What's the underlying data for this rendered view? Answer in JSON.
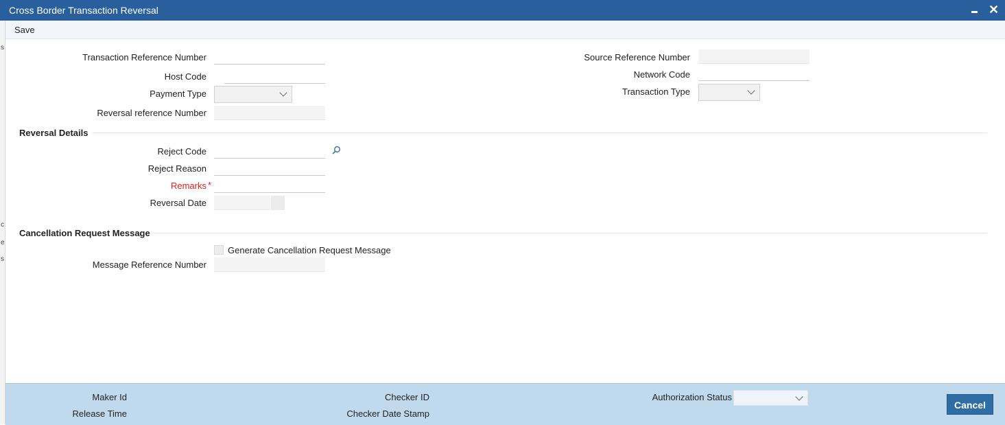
{
  "window": {
    "title": "Cross Border Transaction Reversal",
    "minimize_icon": "minimize-icon",
    "close_icon": "close-icon",
    "close_glyph": "✕"
  },
  "toolbar": {
    "save_label": "Save"
  },
  "main": {
    "transaction_reference_number": {
      "label": "Transaction Reference Number",
      "value": ""
    },
    "host_code": {
      "label": "Host Code",
      "value": ""
    },
    "payment_type": {
      "label": "Payment Type",
      "value": ""
    },
    "reversal_reference_number": {
      "label": "Reversal reference Number",
      "value": ""
    },
    "source_reference_number": {
      "label": "Source Reference Number",
      "value": ""
    },
    "network_code": {
      "label": "Network Code",
      "value": ""
    },
    "transaction_type": {
      "label": "Transaction Type",
      "value": ""
    }
  },
  "reversal_details": {
    "heading": "Reversal Details",
    "reject_code": {
      "label": "Reject Code",
      "value": "",
      "icon": "search-icon"
    },
    "reject_reason": {
      "label": "Reject Reason",
      "value": ""
    },
    "remarks": {
      "label": "Remarks",
      "required_mark": "*",
      "value": ""
    },
    "reversal_date": {
      "label": "Reversal Date",
      "value": ""
    }
  },
  "cancellation": {
    "heading": "Cancellation Request Message",
    "generate_checkbox": {
      "label": "Generate Cancellation Request Message",
      "checked": false
    },
    "message_reference_number": {
      "label": "Message Reference Number",
      "value": ""
    }
  },
  "footer": {
    "maker_id_label": "Maker Id",
    "release_time_label": "Release Time",
    "checker_id_label": "Checker ID",
    "checker_date_stamp_label": "Checker Date Stamp",
    "authorization_status_label": "Authorization Status",
    "authorization_status_value": "",
    "cancel_label": "Cancel"
  },
  "left_edge_fragments": [
    "s",
    "c",
    "e",
    "s"
  ],
  "colors": {
    "title_bar": "#2a5f9e",
    "footer": "#c0d9ec",
    "required": "#e0201a",
    "cancel_button": "#2f6da5"
  }
}
